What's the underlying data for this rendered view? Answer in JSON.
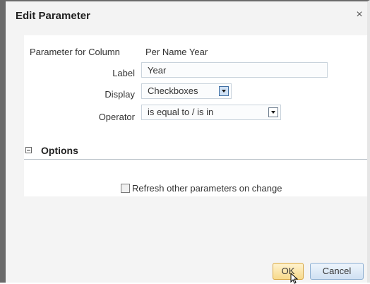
{
  "dialog": {
    "title": "Edit Parameter",
    "close_glyph": "×"
  },
  "form": {
    "param_column_label": "Parameter for Column",
    "param_column_value": "Per Name Year",
    "label_label": "Label",
    "label_value": "Year",
    "display_label": "Display",
    "display_value": "Checkboxes",
    "operator_label": "Operator",
    "operator_value": "is equal to / is in"
  },
  "options": {
    "section_title": "Options",
    "refresh_checkbox_label": "Refresh other parameters on change",
    "refresh_checked": false
  },
  "buttons": {
    "ok_label": "OK",
    "cancel_label": "Cancel"
  },
  "colors": {
    "ok_button_bg": "#f7d98a",
    "cancel_button_bg": "#cfe0f2",
    "content_bg": "#ffffff",
    "dialog_bg": "#f4f4f4"
  },
  "icons": {
    "close": "close-icon",
    "collapse": "collapse-minus-icon",
    "dropdown": "chevron-down-icon",
    "cursor": "mouse-pointer-icon"
  }
}
